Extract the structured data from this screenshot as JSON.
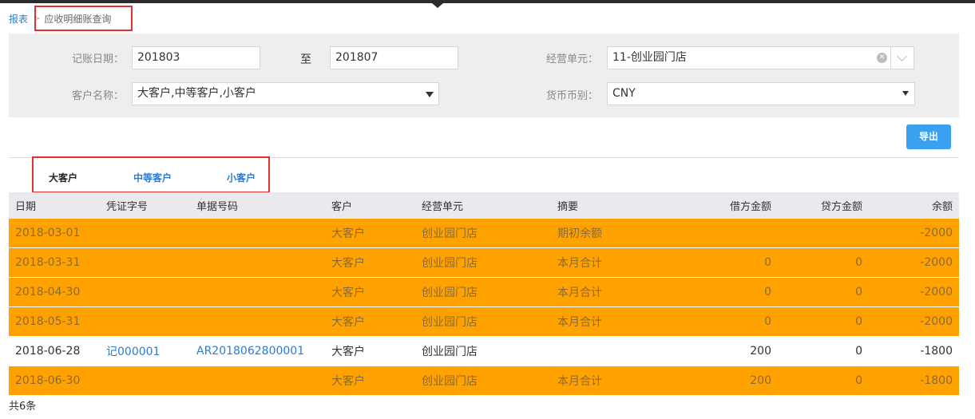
{
  "breadcrumb": {
    "root": "报表",
    "separator": ">",
    "current": "应收明细账查询"
  },
  "filters": {
    "date_label": "记账日期：",
    "date_from": "201803",
    "date_to_label": "至",
    "date_to": "201807",
    "unit_label": "经营单元：",
    "unit_value": "11-创业园门店",
    "customer_label": "客户名称：",
    "customer_value": "大客户,中等客户,小客户",
    "currency_label": "货币币别：",
    "currency_value": "CNY"
  },
  "toolbar": {
    "export_label": "导出"
  },
  "tabs": [
    {
      "label": "大客户",
      "active": true
    },
    {
      "label": "中等客户",
      "active": false
    },
    {
      "label": "小客户",
      "active": false
    }
  ],
  "table": {
    "columns": [
      "日期",
      "凭证字号",
      "单据号码",
      "客户",
      "经营单元",
      "摘要",
      "借方金额",
      "贷方金额",
      "余额"
    ],
    "rows": [
      {
        "date": "2018-03-01",
        "voucher": "",
        "docno": "",
        "customer": "大客户",
        "unit": "创业园门店",
        "summary": "期初余额",
        "debit": "",
        "credit": "",
        "balance": "-2000",
        "highlight": true
      },
      {
        "date": "2018-03-31",
        "voucher": "",
        "docno": "",
        "customer": "大客户",
        "unit": "创业园门店",
        "summary": "本月合计",
        "debit": "0",
        "credit": "0",
        "balance": "-2000",
        "highlight": true
      },
      {
        "date": "2018-04-30",
        "voucher": "",
        "docno": "",
        "customer": "大客户",
        "unit": "创业园门店",
        "summary": "本月合计",
        "debit": "0",
        "credit": "0",
        "balance": "-2000",
        "highlight": true
      },
      {
        "date": "2018-05-31",
        "voucher": "",
        "docno": "",
        "customer": "大客户",
        "unit": "创业园门店",
        "summary": "本月合计",
        "debit": "0",
        "credit": "0",
        "balance": "-2000",
        "highlight": true
      },
      {
        "date": "2018-06-28",
        "voucher": "记000001",
        "docno": "AR2018062800001",
        "customer": "大客户",
        "unit": "创业园门店",
        "summary": "",
        "debit": "200",
        "credit": "0",
        "balance": "-1800",
        "highlight": false
      },
      {
        "date": "2018-06-30",
        "voucher": "",
        "docno": "",
        "customer": "大客户",
        "unit": "创业园门店",
        "summary": "本月合计",
        "debit": "200",
        "credit": "0",
        "balance": "-1800",
        "highlight": true
      }
    ]
  },
  "footer": {
    "count_text": "共6条"
  },
  "colors": {
    "accent": "#3aa0f0",
    "row_highlight": "#ffa200",
    "link": "#2d7bd0",
    "annotation": "#e03030"
  }
}
